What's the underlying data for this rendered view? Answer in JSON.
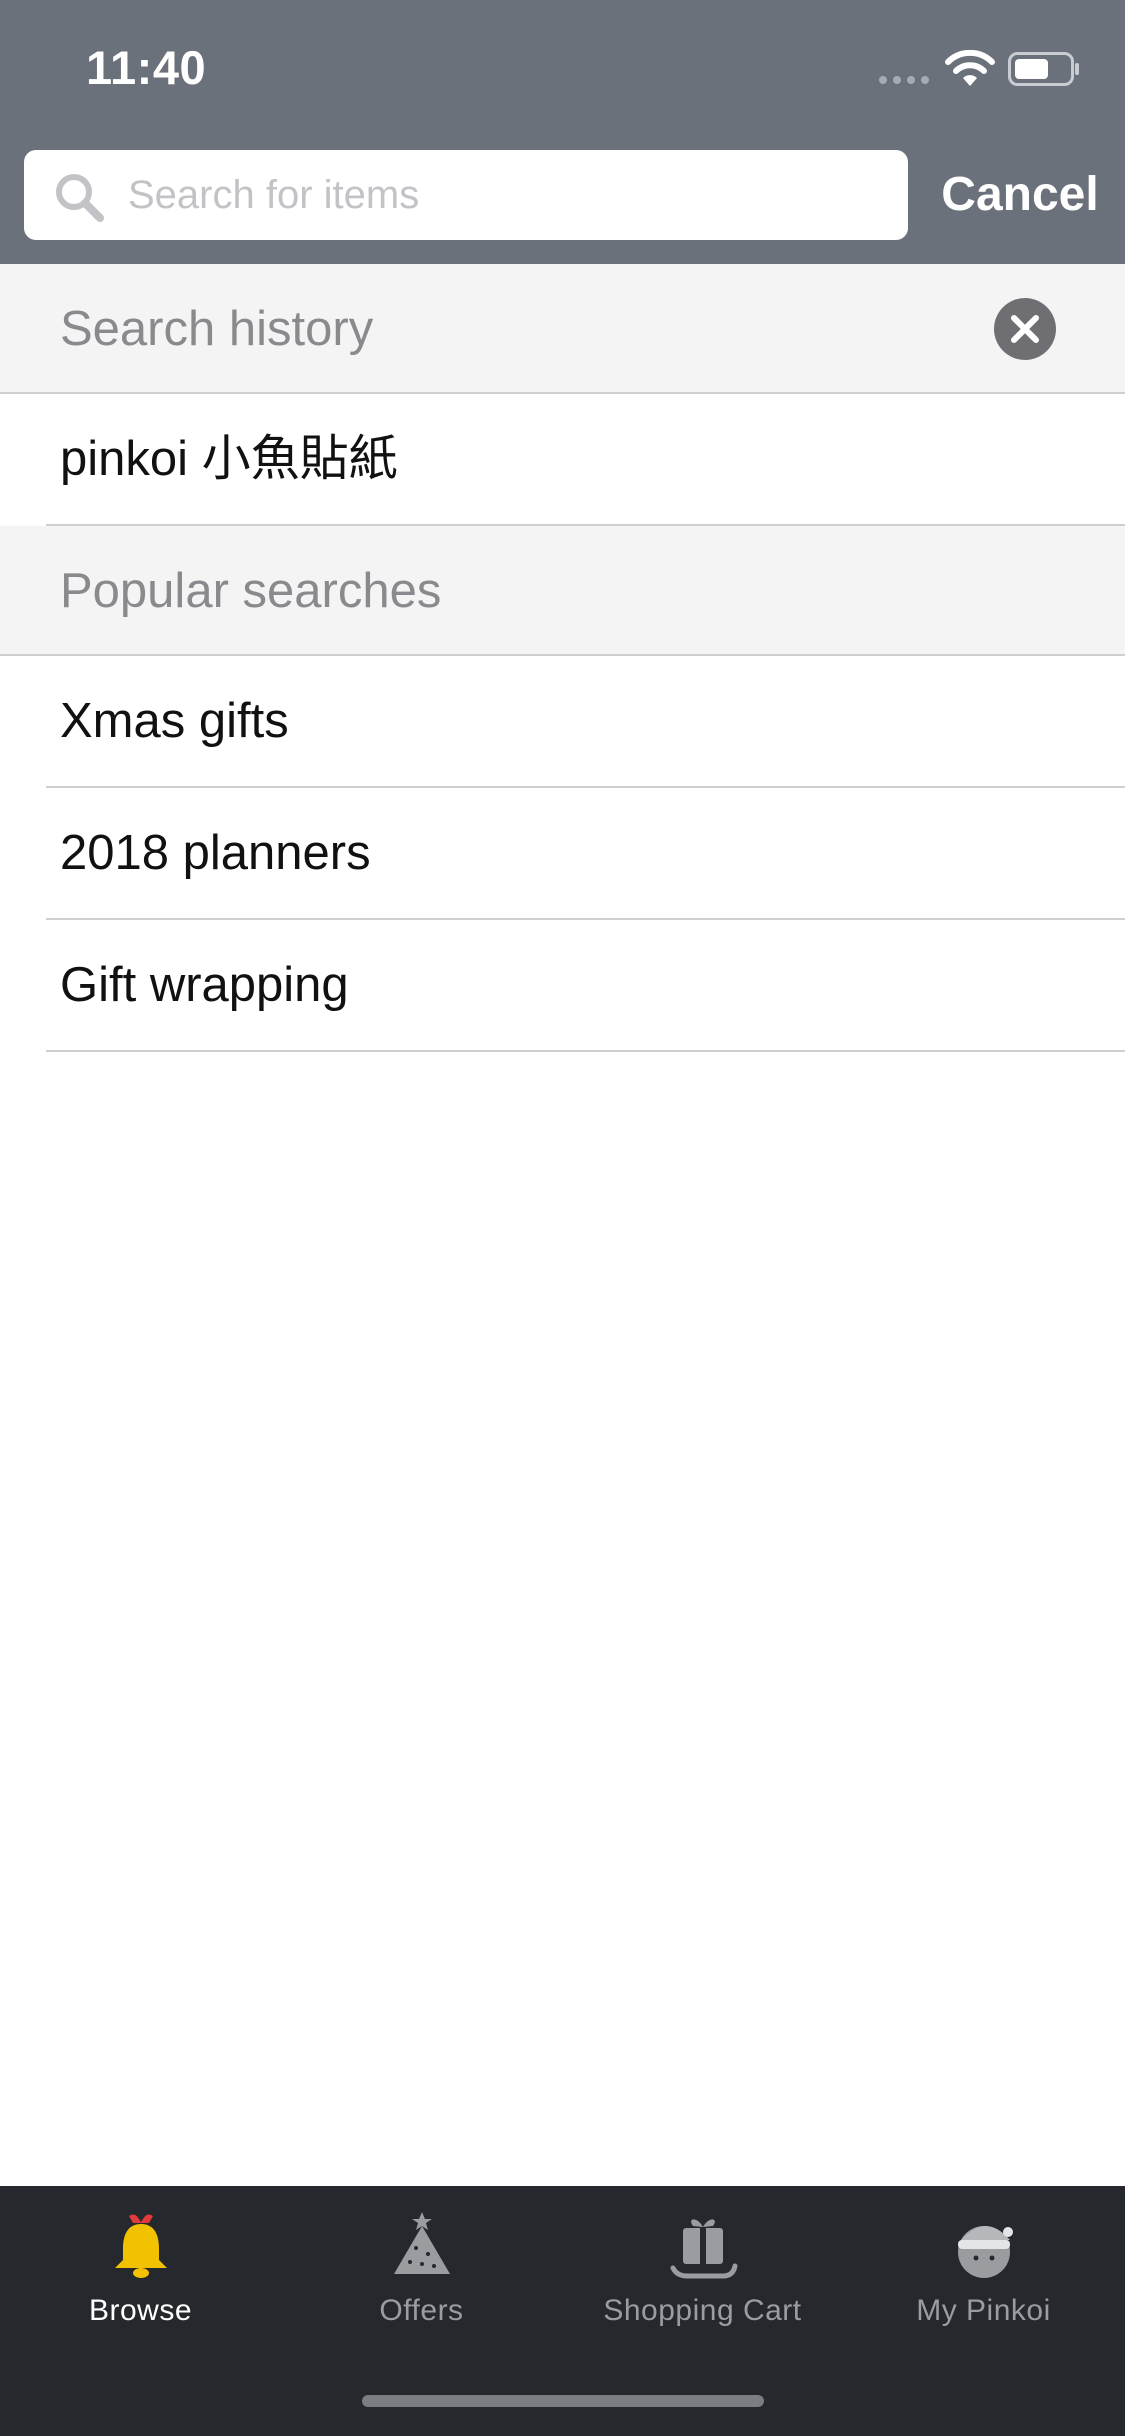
{
  "status_bar": {
    "time": "11:40"
  },
  "search": {
    "placeholder": "Search for items",
    "value": "",
    "cancel_label": "Cancel"
  },
  "history": {
    "title": "Search history",
    "items": [
      {
        "label": "pinkoi 小魚貼紙"
      }
    ]
  },
  "popular": {
    "title": "Popular searches",
    "items": [
      {
        "label": "Xmas gifts"
      },
      {
        "label": "2018 planners"
      },
      {
        "label": "Gift wrapping"
      }
    ]
  },
  "tab_bar": {
    "tabs": [
      {
        "label": "Browse",
        "icon": "bell-icon",
        "active": true
      },
      {
        "label": "Offers",
        "icon": "christmas-tree-icon",
        "active": false
      },
      {
        "label": "Shopping Cart",
        "icon": "gift-sleigh-icon",
        "active": false
      },
      {
        "label": "My Pinkoi",
        "icon": "santa-avatar-icon",
        "active": false
      }
    ]
  },
  "colors": {
    "header_bg": "#6b717b",
    "section_bg": "#f4f4f4",
    "tab_bar_bg": "#25282d",
    "active_tab_icon": "#f2c200"
  }
}
